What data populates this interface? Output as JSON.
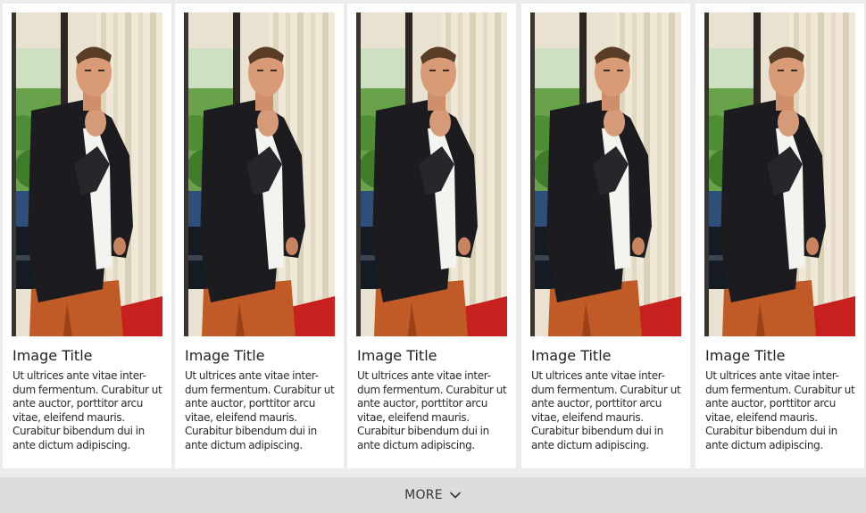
{
  "cards": [
    {
      "title": "Image Title",
      "text": "Ut ultrices ante vitae inter-dum fermentum. Curabitur ut ante auctor, porttitor arcu vitae, eleifend mauris. Curabitur bibendum dui in ante dictum adipiscing."
    },
    {
      "title": "Image Title",
      "text": "Ut ultrices ante vitae inter-dum fermentum. Curabitur ut ante auctor, porttitor arcu vitae, eleifend mauris. Curabitur bibendum dui in ante dictum adipiscing."
    },
    {
      "title": "Image Title",
      "text": "Ut ultrices ante vitae inter-dum fermentum. Curabitur ut ante auctor, porttitor arcu vitae, eleifend mauris. Curabitur bibendum dui in ante dictum adipiscing."
    },
    {
      "title": "Image Title",
      "text": "Ut ultrices ante vitae inter-dum fermentum. Curabitur ut ante auctor, porttitor arcu vitae, eleifend mauris. Curabitur bibendum dui in ante dictum adipiscing."
    },
    {
      "title": "Image Title",
      "text": "Ut ultrices ante vitae inter-dum fermentum. Curabitur ut ante auctor, porttitor arcu vitae, eleifend mauris. Curabitur bibendum dui in ante dictum adipiscing."
    }
  ],
  "more": {
    "label": "MORE",
    "icon": "chevron-down-icon"
  }
}
